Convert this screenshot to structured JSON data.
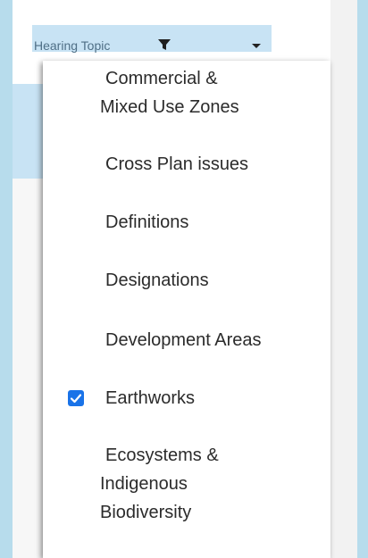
{
  "filter_header": {
    "label": "Hearing Topic",
    "filter_icon": "filter-icon",
    "dropdown_icon": "chevron-down-icon"
  },
  "dropdown": {
    "items": [
      {
        "label_line1": "Commercial &",
        "label_line2": "Mixed Use Zones",
        "checked": false
      },
      {
        "label": "Cross Plan issues",
        "checked": false
      },
      {
        "label": "Definitions",
        "checked": false
      },
      {
        "label": "Designations",
        "checked": false
      },
      {
        "label": "Development Areas",
        "checked": false
      },
      {
        "label": "Earthworks",
        "checked": true
      },
      {
        "label_line1": "Ecosystems &",
        "label_line2": "Indigenous",
        "label_line3": "Biodiversity",
        "checked": false
      }
    ]
  },
  "colors": {
    "accent": "#1a73e8",
    "header_bg": "#c8e3f4",
    "page_bg": "#b7dcec"
  }
}
